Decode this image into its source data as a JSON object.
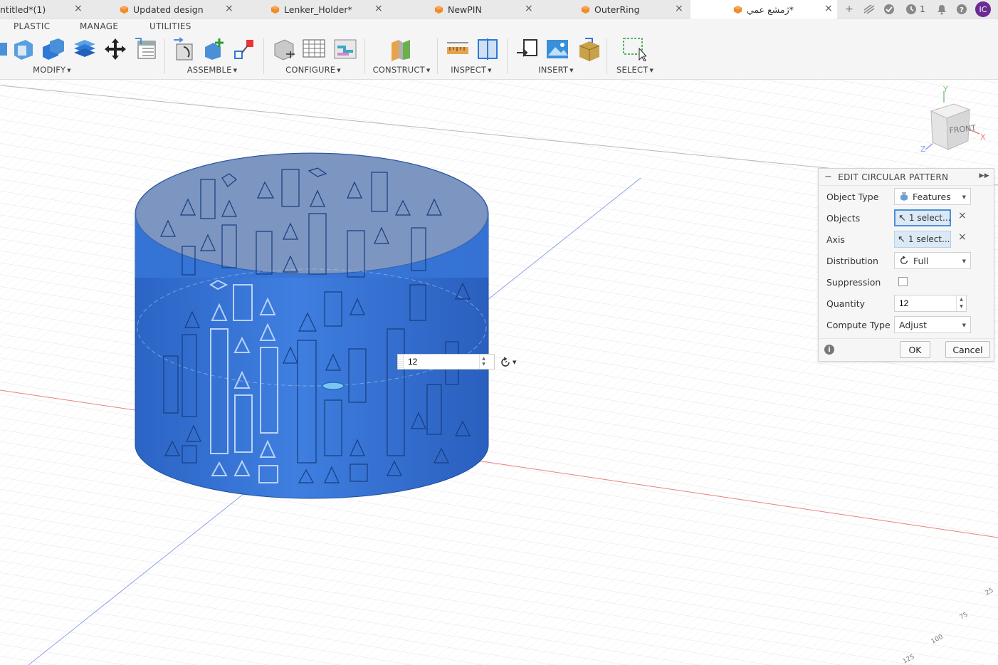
{
  "tabs": [
    {
      "label": "ntitled*(1)"
    },
    {
      "label": "Updated design"
    },
    {
      "label": "Lenker_Holder*"
    },
    {
      "label": "NewPIN"
    },
    {
      "label": "OuterRing"
    },
    {
      "label": "ژمشع عمي*"
    }
  ],
  "tab_close": "×",
  "header": {
    "job_count": "1",
    "avatar_initials": "IC"
  },
  "toolbar": {
    "tabs": [
      "PLASTIC",
      "MANAGE",
      "UTILITIES"
    ],
    "groups": {
      "modify": "MODIFY",
      "assemble": "ASSEMBLE",
      "configure": "CONFIGURE",
      "construct": "CONSTRUCT",
      "inspect": "INSPECT",
      "insert": "INSERT",
      "select": "SELECT"
    }
  },
  "canvas": {
    "quantity_value": "12",
    "navcube_face": "FRONT",
    "axes": {
      "y": "Y",
      "x": "X",
      "z": "Z"
    },
    "ruler_labels": [
      "25",
      "75",
      "100",
      "125"
    ]
  },
  "colors": {
    "body_blue": "#2f6fd0",
    "accent": "#4a90d9",
    "tab_icon": "#f28c28",
    "avatar": "#6a2c91"
  },
  "dialog": {
    "title": "EDIT CIRCULAR PATTERN",
    "object_type_label": "Object Type",
    "object_type_value": "Features",
    "objects_label": "Objects",
    "objects_value": "1 select...",
    "axis_label": "Axis",
    "axis_value": "1 select...",
    "distribution_label": "Distribution",
    "distribution_value": "Full",
    "suppression_label": "Suppression",
    "quantity_label": "Quantity",
    "quantity_value": "12",
    "compute_type_label": "Compute Type",
    "compute_type_value": "Adjust",
    "ok_label": "OK",
    "cancel_label": "Cancel"
  }
}
